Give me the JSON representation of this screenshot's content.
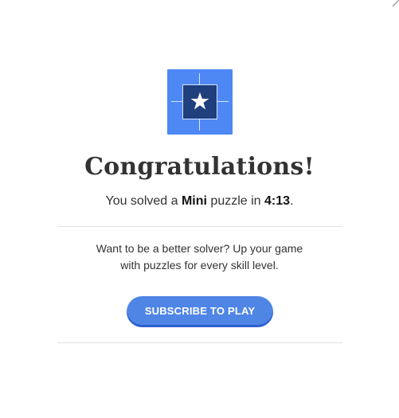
{
  "modal": {
    "title": "Congratulations!",
    "solve_message": {
      "prefix": "You solved a ",
      "puzzle_type": "Mini",
      "middle": " puzzle in ",
      "time": "4:13",
      "suffix": "."
    },
    "promo": {
      "line1": "Want to be a better solver? Up your game",
      "line2": "with puzzles for every skill level."
    },
    "subscribe_button_label": "Subscribe to Play"
  },
  "icons": {
    "logo": "mini-crossword-star-icon",
    "close": "close-icon"
  },
  "colors": {
    "logo_background": "#4d88f5",
    "logo_square": "#1f3f7d",
    "button_background": "#4f85e5",
    "button_shadow": "#2e5fd1",
    "text": "#333333",
    "divider": "#e2e2e2"
  }
}
